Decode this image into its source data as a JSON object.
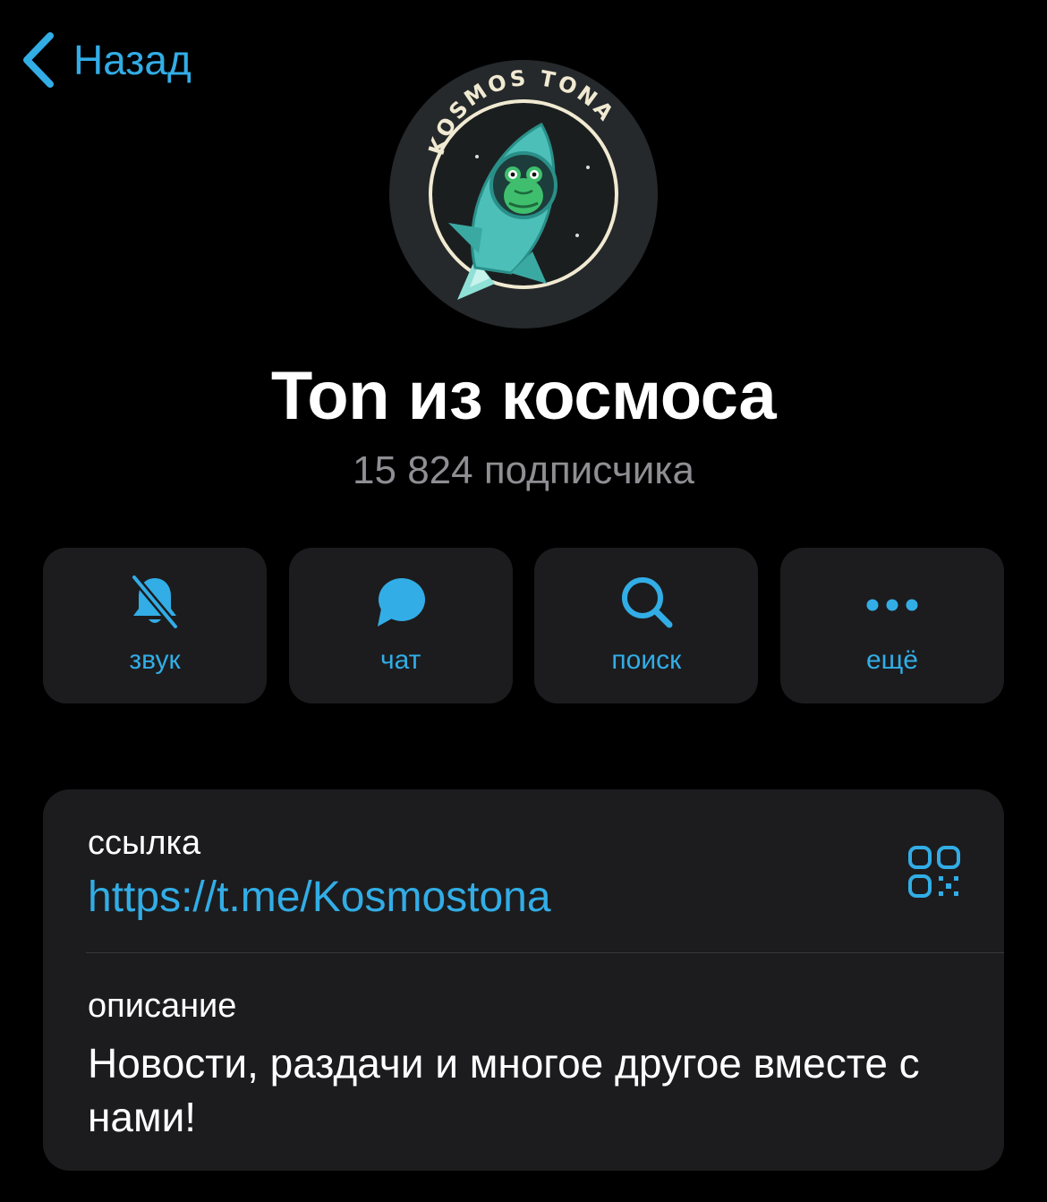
{
  "colors": {
    "accent": "#32ade6",
    "background": "#000000",
    "card": "#1c1c1e",
    "secondary_text": "#8e8e93",
    "avatar_teal": "#4cbfb8"
  },
  "nav": {
    "back_label": "Назад",
    "back_icon": "chevron-left-icon"
  },
  "channel": {
    "avatar_text": "KOSMOS TONA",
    "title": "Ton из космоса",
    "subscribers": "15 824 подписчика"
  },
  "actions": [
    {
      "label": "звук",
      "icon": "bell-slash-icon"
    },
    {
      "label": "чат",
      "icon": "chat-bubble-icon"
    },
    {
      "label": "поиск",
      "icon": "search-icon"
    },
    {
      "label": "ещё",
      "icon": "more-dots-icon"
    }
  ],
  "info": {
    "link_label": "ссылка",
    "link_value": "https://t.me/Kosmostona",
    "qr_icon": "qr-code-icon",
    "description_label": "описание",
    "description_value": "Новости, раздачи и многое другое вместе с нами!"
  }
}
